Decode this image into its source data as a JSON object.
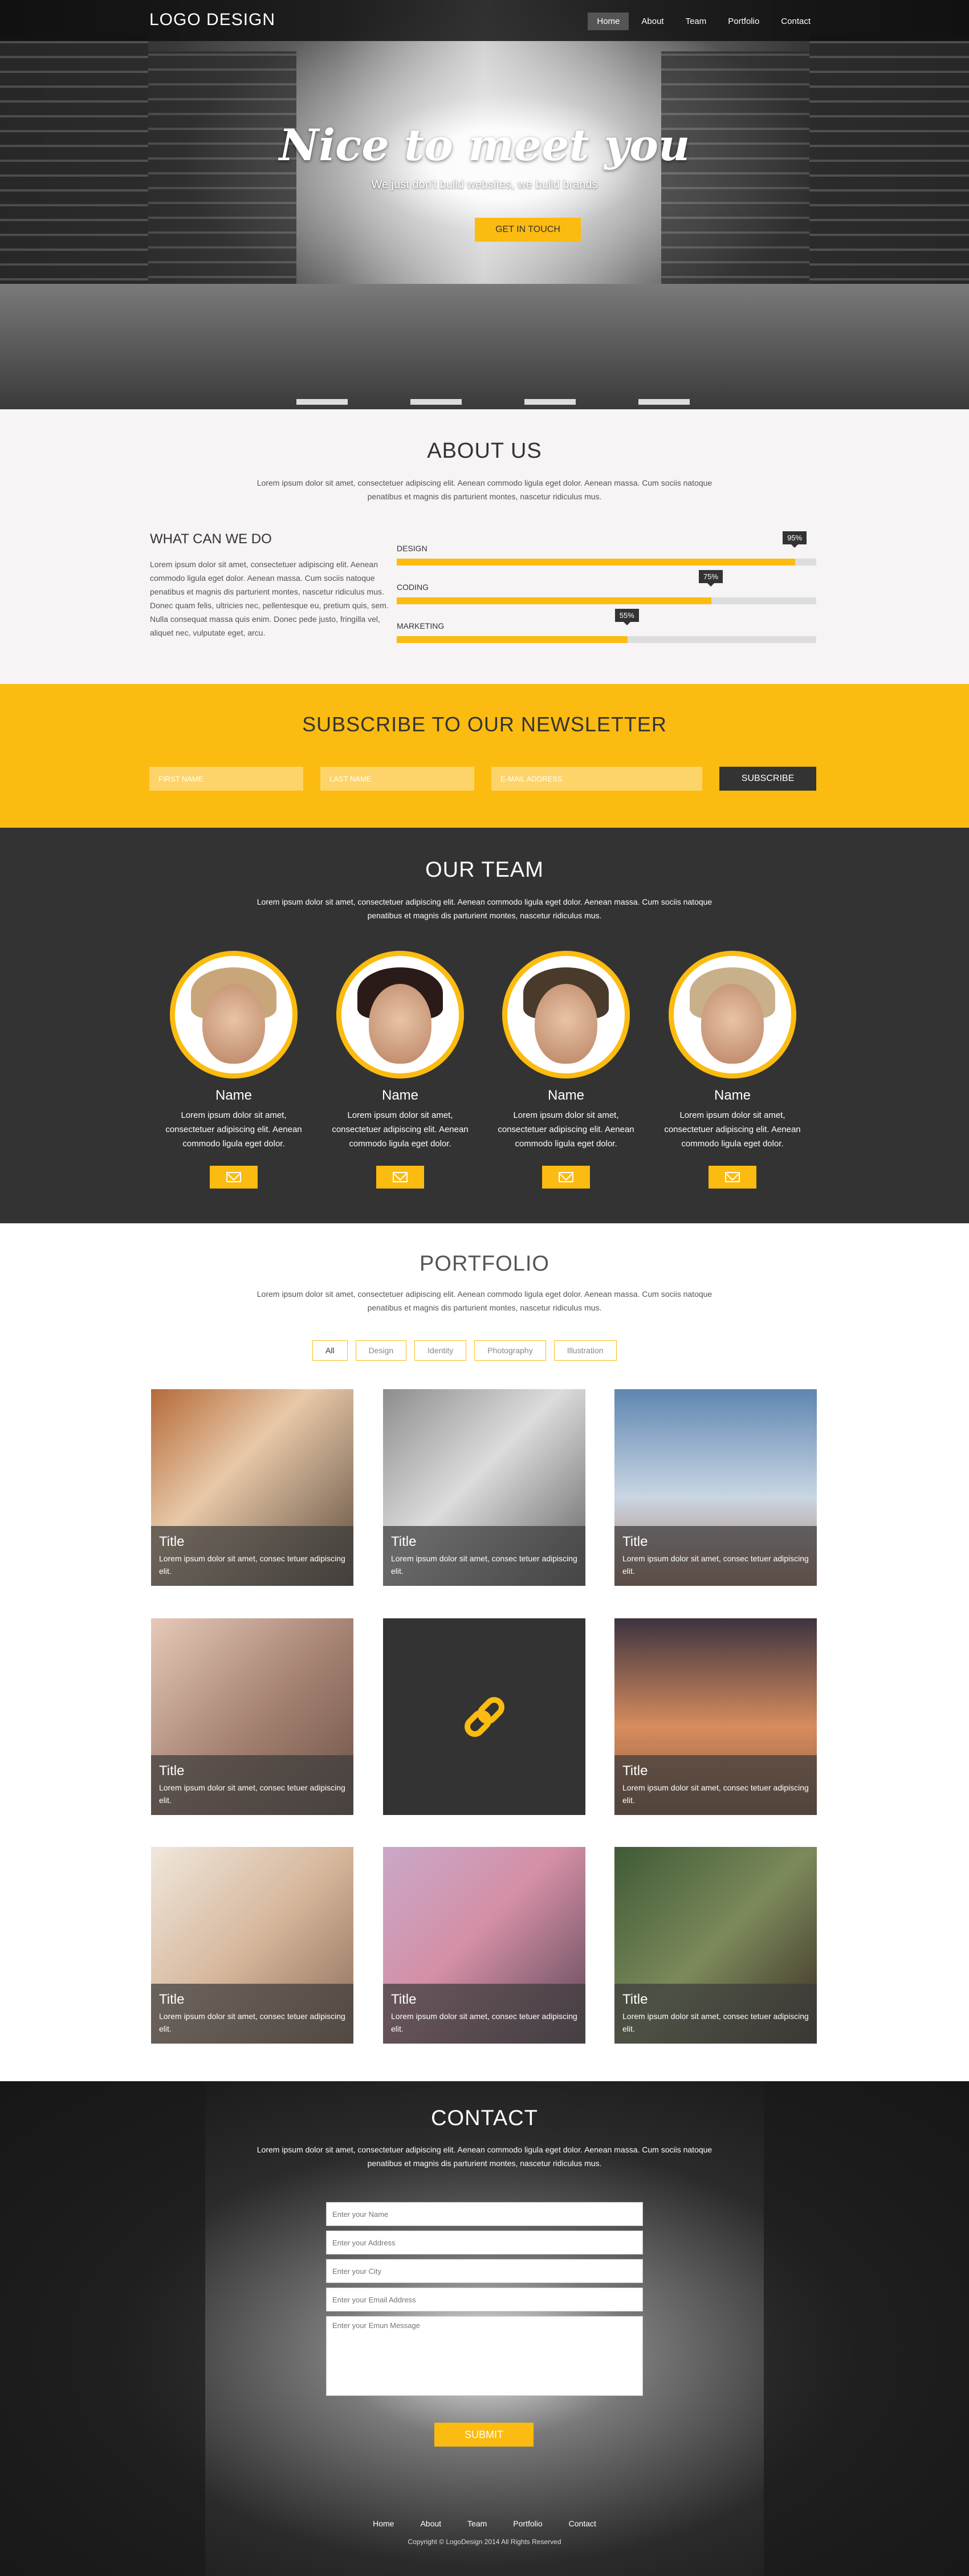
{
  "nav": {
    "logo": "LOGO DESIGN",
    "items": [
      {
        "label": "Home",
        "active": true
      },
      {
        "label": "About",
        "active": false
      },
      {
        "label": "Team",
        "active": false
      },
      {
        "label": "Portfolio",
        "active": false
      },
      {
        "label": "Contact",
        "active": false
      }
    ]
  },
  "hero": {
    "heading": "Nice to meet you",
    "subtitle": "We just don't build websites, we build brands",
    "button": "GET IN TOUCH"
  },
  "about": {
    "title": "ABOUT US",
    "lead": "Lorem ipsum dolor sit amet, consectetuer adipiscing elit. Aenean commodo ligula eget dolor. Aenean massa. Cum sociis natoque penatibus et magnis dis parturient montes, nascetur ridiculus mus.",
    "what_title": "WHAT CAN WE DO",
    "what_text": "Lorem ipsum dolor sit amet, consectetuer adipiscing elit. Aenean commodo ligula eget dolor. Aenean massa. Cum sociis natoque penatibus et magnis dis parturient montes, nascetur ridiculus mus. Donec quam felis, ultricies nec, pellentesque eu, pretium quis, sem. Nulla consequat massa quis enim. Donec pede justo, fringilla vel, aliquet nec, vulputate eget, arcu.",
    "skills": [
      {
        "label": "DESIGN",
        "percent": 95,
        "display": "95%"
      },
      {
        "label": "CODING",
        "percent": 75,
        "display": "75%"
      },
      {
        "label": "MARKETING",
        "percent": 55,
        "display": "55%"
      }
    ]
  },
  "newsletter": {
    "title": "SUBSCRIBE TO OUR NEWSLETTER",
    "first_name_placeholder": "FIRST NAME",
    "last_name_placeholder": "LAST NAME",
    "email_placeholder": "E-MAIL ADDRESS",
    "button": "SUBSCRIBE"
  },
  "team": {
    "title": "OUR TEAM",
    "lead": "Lorem ipsum dolor sit amet, consectetuer adipiscing elit. Aenean commodo ligula eget dolor. Aenean massa. Cum sociis natoque penatibus et magnis dis parturient montes, nascetur ridiculus mus.",
    "members": [
      {
        "name": "Name",
        "desc": "Lorem ipsum dolor sit amet, consectetuer adipiscing elit. Aenean commodo ligula eget dolor."
      },
      {
        "name": "Name",
        "desc": "Lorem ipsum dolor sit amet, consectetuer adipiscing elit. Aenean commodo ligula eget dolor."
      },
      {
        "name": "Name",
        "desc": "Lorem ipsum dolor sit amet, consectetuer adipiscing elit. Aenean commodo ligula eget dolor."
      },
      {
        "name": "Name",
        "desc": "Lorem ipsum dolor sit amet, consectetuer adipiscing elit. Aenean commodo ligula eget dolor."
      }
    ]
  },
  "portfolio": {
    "title": "PORTFOLIO",
    "lead": "Lorem ipsum dolor sit amet, consectetuer adipiscing elit. Aenean commodo ligula eget dolor. Aenean massa. Cum sociis natoque penatibus et magnis dis parturient montes, nascetur ridiculus mus.",
    "filters": [
      {
        "label": "All",
        "active": true
      },
      {
        "label": "Design",
        "active": false
      },
      {
        "label": "Identity",
        "active": false
      },
      {
        "label": "Photography",
        "active": false
      },
      {
        "label": "Illustration",
        "active": false
      }
    ],
    "tiles": [
      {
        "title": "Title",
        "desc": "Lorem ipsum dolor sit amet, consec tetuer adipiscing elit.",
        "photo": "turntable-photo"
      },
      {
        "title": "Title",
        "desc": "Lorem ipsum dolor sit amet, consec tetuer adipiscing elit.",
        "photo": "splash-face-photo"
      },
      {
        "title": "Title",
        "desc": "Lorem ipsum dolor sit amet, consec tetuer adipiscing elit.",
        "photo": "bicycle-photo"
      },
      {
        "title": "Title",
        "desc": "Lorem ipsum dolor sit amet, consec tetuer adipiscing elit.",
        "photo": "microphone-photo"
      },
      {
        "title": "",
        "desc": "",
        "photo": "link-icon-tile"
      },
      {
        "title": "Title",
        "desc": "Lorem ipsum dolor sit amet, consec tetuer adipiscing elit.",
        "photo": "sunset-tree-photo"
      },
      {
        "title": "Title",
        "desc": "Lorem ipsum dolor sit amet, consec tetuer adipiscing elit.",
        "photo": "boxing-couple-photo"
      },
      {
        "title": "Title",
        "desc": "Lorem ipsum dolor sit amet, consec tetuer adipiscing elit.",
        "photo": "rusty-truck-photo"
      },
      {
        "title": "Title",
        "desc": "Lorem ipsum dolor sit amet, consec tetuer adipiscing elit.",
        "photo": "funny-glasses-photo"
      }
    ]
  },
  "contact": {
    "title": "CONTACT",
    "lead": "Lorem ipsum dolor sit amet, consectetuer adipiscing elit. Aenean commodo ligula eget dolor. Aenean massa. Cum sociis natoque penatibus et magnis dis parturient montes, nascetur ridiculus mus.",
    "name_placeholder": "Enter your Name",
    "address_placeholder": "Enter your Address",
    "city_placeholder": "Enter your City",
    "email_placeholder": "Enter your Email Address",
    "message_placeholder": "Enter your Emun Message",
    "submit": "SUBMIT"
  },
  "footer": {
    "items": [
      "Home",
      "About",
      "Team",
      "Portfolio",
      "Contact"
    ],
    "copyright": "Copyright © LogoDesign 2014 All Rights Reserved"
  },
  "colors": {
    "accent": "#fbbb10",
    "dark": "#333333",
    "light_bg": "#f6f4f4"
  }
}
